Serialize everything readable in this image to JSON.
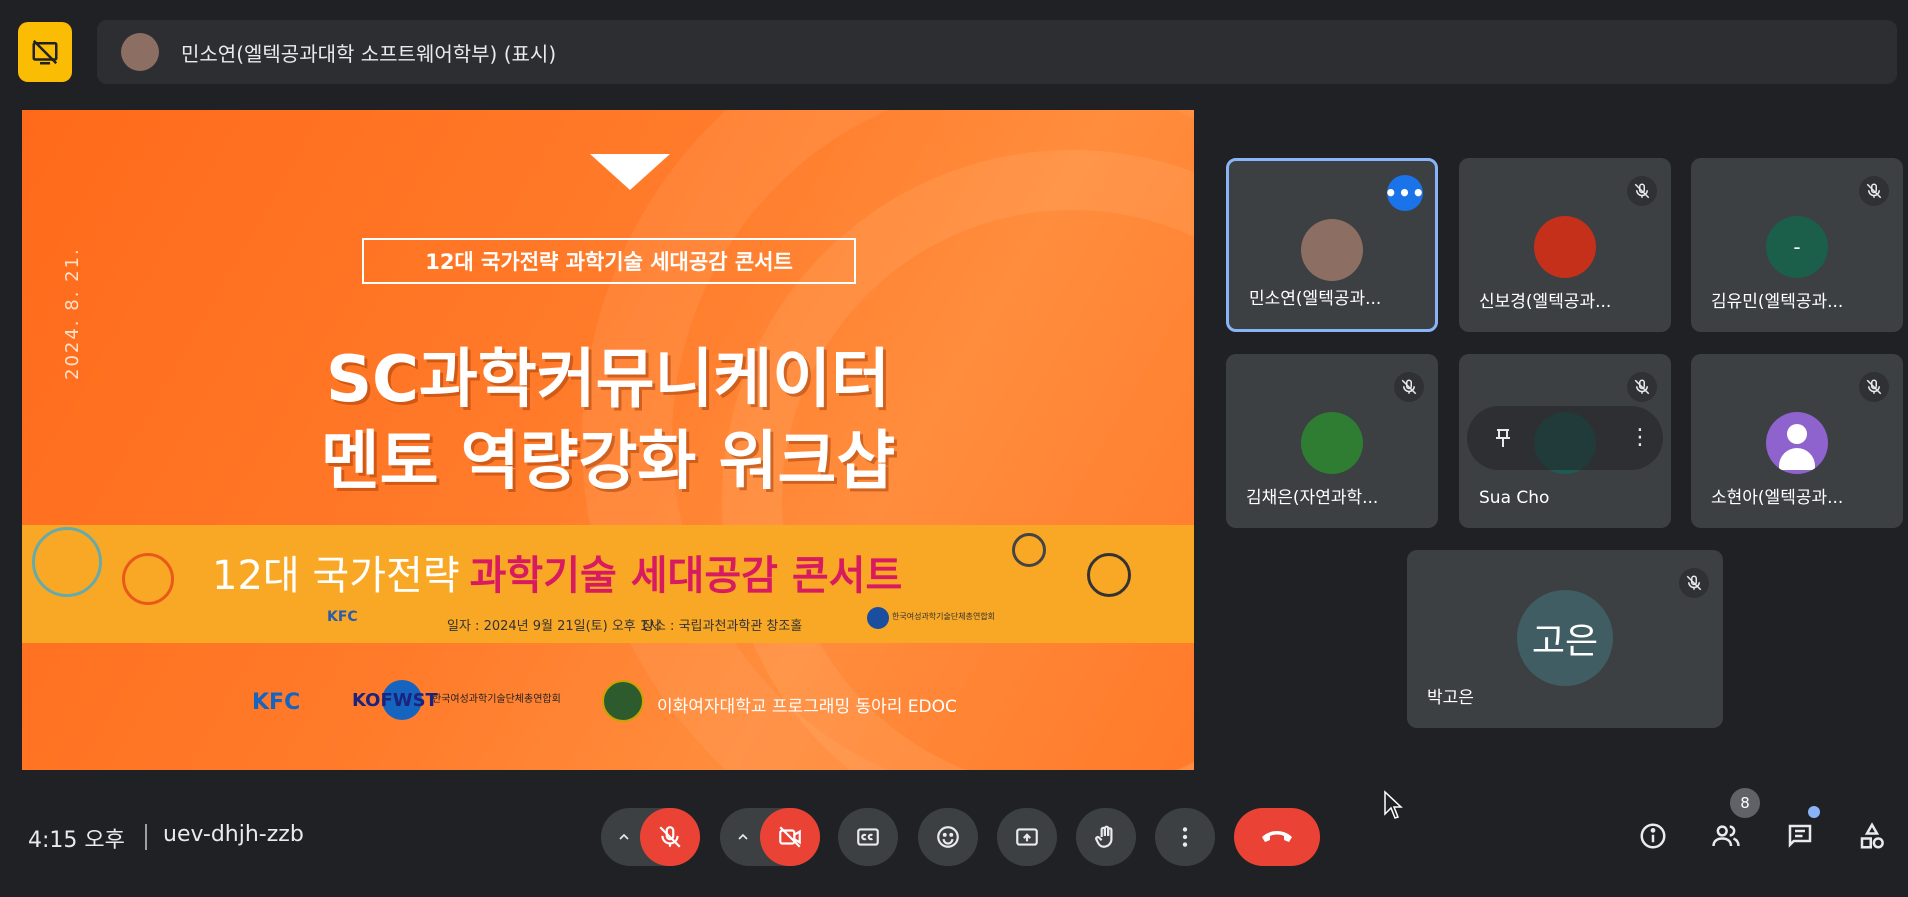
{
  "presenter_bar": {
    "text": "민소연(엘텍공과대학 소프트웨어학부) (표시)"
  },
  "slide": {
    "date": "2024. 8. 21.",
    "box_title": "12대 국가전략 과학기술 세대공감 콘서트",
    "title_line1": "SC과학커뮤니케이터",
    "title_line2": "멘토 역량강화 워크샵",
    "banner_prefix": "12대 국가전략",
    "banner_highlight": "과학기술 세대공감 콘서트",
    "banner_date": "일자 : 2024년 9월 21일(토) 오후 1시",
    "banner_place": "장소 : 국립과천과학관 창조홀",
    "banner_kfc": "KFC",
    "banner_kofwst": "한국여성과학기술단체총연합회",
    "logo_kfc": "KFC",
    "logo_kofwst": "KOFWST",
    "logo_kofwst_text": "한국여성과학기술단체총연합회",
    "logo_edoc": "이화여자대학교 프로그래밍 동아리 EDOC"
  },
  "participants": [
    {
      "name": "민소연(엘텍공과...",
      "avatar_color": "#8d6e63",
      "muted": false,
      "active": true
    },
    {
      "name": "신보경(엘텍공과...",
      "avatar_color": "#c5301a",
      "muted": true
    },
    {
      "name": "김유민(엘텍공과...",
      "avatar_color": "#1b5e4a",
      "avatar_text": "-",
      "muted": true
    },
    {
      "name": "김채은(자연과학...",
      "avatar_color": "#2e7d32",
      "muted": true
    },
    {
      "name": "Sua Cho",
      "avatar_color": "#1f5b52",
      "muted": true
    },
    {
      "name": "소현아(엘텍공과...",
      "avatar_color": "#8e63ce",
      "muted": true
    },
    {
      "name": "박고은",
      "avatar_text": "고은",
      "avatar_color": "#3f5d63",
      "muted": true
    }
  ],
  "bottom_bar": {
    "time": "4:15 오후",
    "meeting_code": "uev-dhjh-zzb",
    "participant_count": "8"
  },
  "colors": {
    "background": "#202124",
    "tile": "#3c4043",
    "active_border": "#8ab4f8",
    "danger": "#ea4335",
    "present_badge": "#fbbc04"
  }
}
